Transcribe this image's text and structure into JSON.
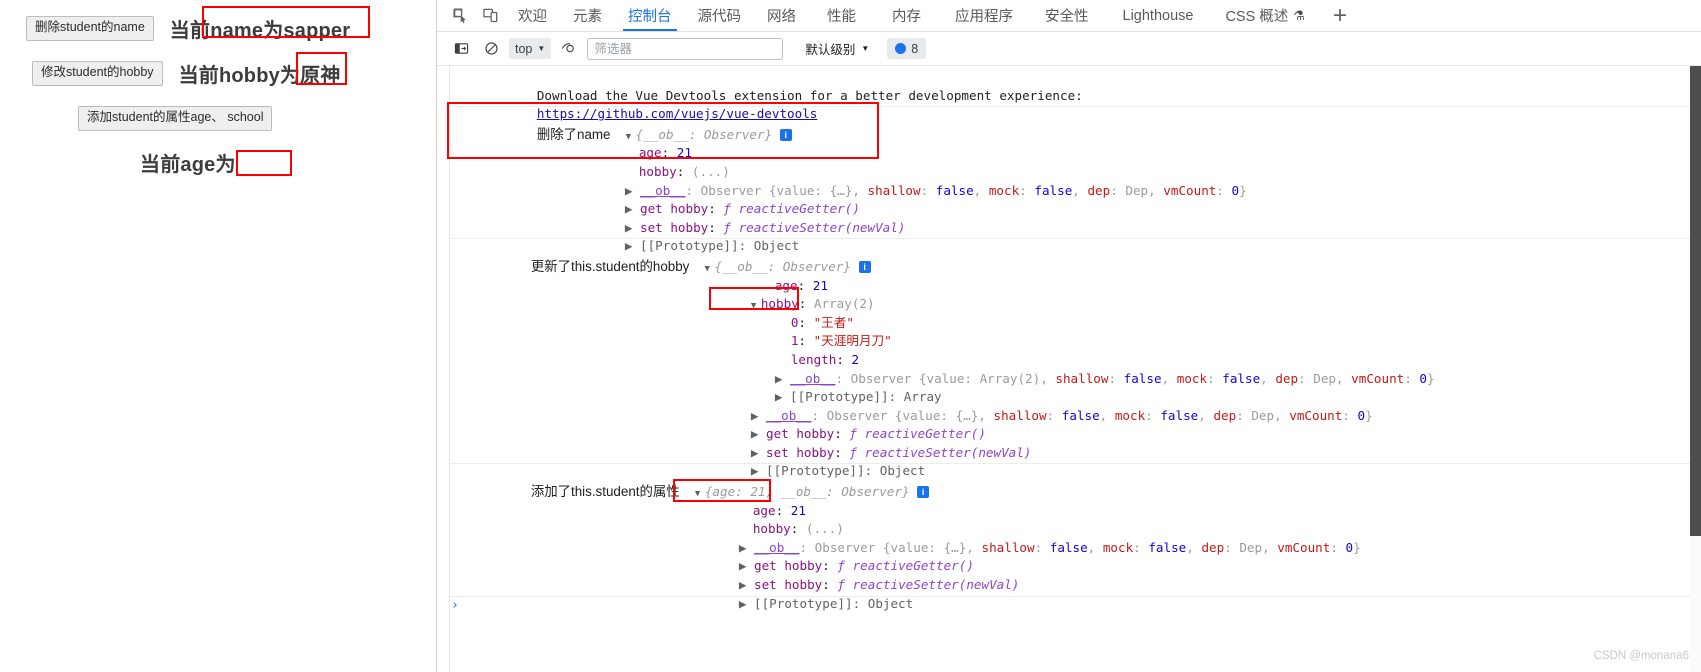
{
  "page": {
    "rows": [
      {
        "button": "删除student的name",
        "label_prefix": "当前",
        "label_text": "name为sapper"
      },
      {
        "button": "修改student的hobby",
        "label_prefix": "当前",
        "label_text": "hobby为原神"
      },
      {
        "button": "添加student的属性age、 school",
        "label_prefix": "",
        "label_text": ""
      }
    ],
    "age_label": "当前age为",
    "age_value": ""
  },
  "devtools": {
    "tabs": [
      {
        "label": "欢迎",
        "active": false
      },
      {
        "label": "元素",
        "active": false
      },
      {
        "label": "控制台",
        "active": true
      },
      {
        "label": "源代码",
        "active": false
      },
      {
        "label": "网络",
        "active": false
      },
      {
        "label": "性能",
        "active": false
      },
      {
        "label": "内存",
        "active": false
      },
      {
        "label": "应用程序",
        "active": false
      },
      {
        "label": "安全性",
        "active": false
      },
      {
        "label": "Lighthouse",
        "active": false
      },
      {
        "label": "CSS 概述",
        "active": false,
        "beaker": "⚗"
      }
    ],
    "add_tab": "+",
    "inspect_icon": "inspect-element-icon",
    "device_icon": "device-toolbar-icon",
    "filterbar": {
      "sidebar_icon": "console-sidebar-icon",
      "clear_icon": "clear-console-icon",
      "context": "top",
      "eye_icon": "live-expression-icon",
      "filter_placeholder": "筛选器",
      "filter_value": "",
      "level": "默认级别",
      "issues_count": "8"
    },
    "console": {
      "vue_line1": "Download the Vue Devtools extension for a better development experience:",
      "vue_link": "https://github.com/vuejs/vue-devtools",
      "groups": [
        {
          "label": "删除了name",
          "header": "{__ob__: Observer}",
          "info": "i",
          "lines": [
            {
              "indent": 8,
              "text": "age: 21",
              "kind": "prop-num",
              "key": "age",
              "value": "21"
            },
            {
              "indent": 8,
              "text": "hobby: (...)",
              "kind": "prop-ellipsis",
              "key": "hobby",
              "value": "(...)"
            },
            {
              "indent": 7,
              "kind": "ob",
              "text": "__ob__: Observer {value: {…}, shallow: false, mock: false, dep: Dep, vmCount: 0}"
            },
            {
              "indent": 7,
              "kind": "getter",
              "text": "get hobby: ƒ reactiveGetter()"
            },
            {
              "indent": 7,
              "kind": "setter",
              "text": "set hobby: ƒ reactiveSetter(newVal)"
            },
            {
              "indent": 7,
              "kind": "proto",
              "text": "[[Prototype]]: Object"
            }
          ]
        },
        {
          "label": "更新了this.student的hobby",
          "header": "{__ob__: Observer}",
          "info": "i",
          "lines": [
            {
              "indent": 16,
              "kind": "prop-num",
              "key": "age",
              "value": "21"
            },
            {
              "indent": 15,
              "kind": "arr-head",
              "key": "hobby",
              "value": "Array(2)"
            },
            {
              "indent": 17,
              "kind": "idx-str",
              "key": "0",
              "value": "\"王者\""
            },
            {
              "indent": 17,
              "kind": "idx-str",
              "key": "1",
              "value": "\"天涯明月刀\""
            },
            {
              "indent": 17,
              "kind": "prop-num",
              "key": "length",
              "value": "2"
            },
            {
              "indent": 16,
              "kind": "ob",
              "text": "__ob__: Observer {value: Array(2), shallow: false, mock: false, dep: Dep, vmCount: 0}"
            },
            {
              "indent": 16,
              "kind": "proto",
              "text": "[[Prototype]]: Array"
            },
            {
              "indent": 15,
              "kind": "ob",
              "text": "__ob__: Observer {value: {…}, shallow: false, mock: false, dep: Dep, vmCount: 0}"
            },
            {
              "indent": 15,
              "kind": "getter",
              "text": "get hobby: ƒ reactiveGetter()"
            },
            {
              "indent": 15,
              "kind": "setter",
              "text": "set hobby: ƒ reactiveSetter(newVal)"
            },
            {
              "indent": 15,
              "kind": "proto",
              "text": "[[Prototype]]: Object"
            }
          ]
        },
        {
          "label": "添加了this.student的属性",
          "header": "{age: 21, __ob__: Observer}",
          "info": "i",
          "lines": [
            {
              "indent": 15,
              "kind": "prop-num",
              "key": "age",
              "value": "21"
            },
            {
              "indent": 15,
              "kind": "prop-ellipsis",
              "key": "hobby",
              "value": "(...)"
            },
            {
              "indent": 14,
              "kind": "ob",
              "text": "__ob__: Observer {value: {…}, shallow: false, mock: false, dep: Dep, vmCount: 0}"
            },
            {
              "indent": 14,
              "kind": "getter",
              "text": "get hobby: ƒ reactiveGetter()"
            },
            {
              "indent": 14,
              "kind": "setter",
              "text": "set hobby: ƒ reactiveSetter(newVal)"
            },
            {
              "indent": 14,
              "kind": "proto",
              "text": "[[Prototype]]: Object"
            }
          ]
        }
      ],
      "prompt": "›"
    },
    "watermark": "CSDN @monana6"
  },
  "colors": {
    "highlight": "#fb0000",
    "accent": "#1a73e8",
    "link": "#1a0dab",
    "string": "#c41a16",
    "number": "#1c00cf",
    "property": "#881280"
  }
}
